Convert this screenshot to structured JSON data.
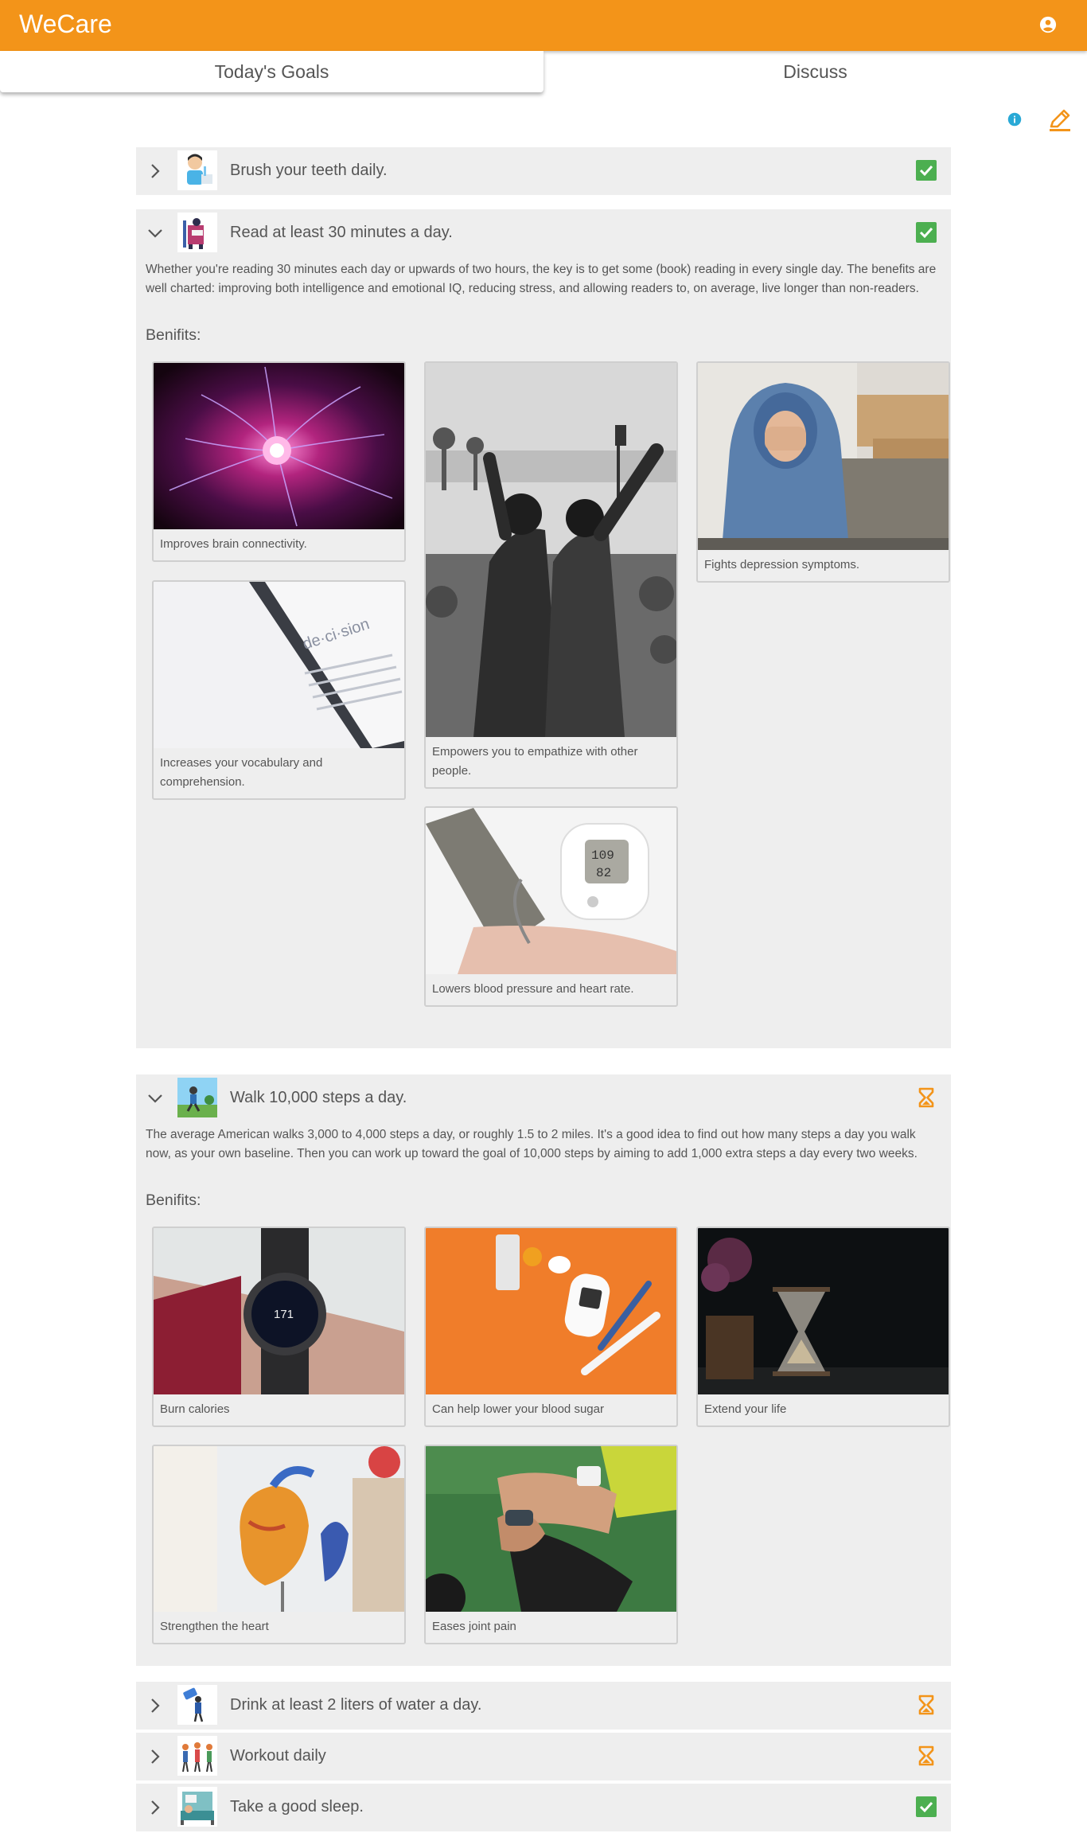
{
  "app": {
    "title": "WeCare"
  },
  "tabs": [
    {
      "label": "Today's Goals"
    },
    {
      "label": "Discuss"
    }
  ],
  "colors": {
    "accent": "#f39419",
    "done": "#4caf50",
    "info": "#29a9d6"
  },
  "toolbar": {
    "info_icon": "info-icon",
    "edit_icon": "pencil-edit-icon"
  },
  "goals": [
    {
      "title": "Brush your teeth daily.",
      "status": "done",
      "expanded": false
    },
    {
      "title": "Read at least 30 minutes a day.",
      "status": "done",
      "expanded": true,
      "description": "Whether you're reading 30 minutes each day or upwards of two hours, the key is to get some (book) reading in every single day. The benefits are well charted: improving both intelligence and emotional IQ, reducing stress, and allowing readers to, on average, live longer than non-readers.",
      "benefits_label": "Benifits:",
      "benefits": [
        {
          "caption": "Improves brain connectivity."
        },
        {
          "caption": "Empowers you to empathize with other people."
        },
        {
          "caption": "Fights depression symptoms."
        },
        {
          "caption": "Increases your vocabulary and comprehension."
        },
        {
          "caption": "Lowers blood pressure and heart rate."
        }
      ]
    },
    {
      "title": "Walk 10,000 steps a day.",
      "status": "pending",
      "expanded": true,
      "description": "The average American walks 3,000 to 4,000 steps a day, or roughly 1.5 to 2 miles. It's a good idea to find out how many steps a day you walk now, as your own baseline. Then you can work up toward the goal of 10,000 steps by aiming to add 1,000 extra steps a day every two weeks.",
      "benefits_label": "Benifits:",
      "benefits": [
        {
          "caption": "Burn calories"
        },
        {
          "caption": "Can help lower your blood sugar"
        },
        {
          "caption": "Extend your life"
        },
        {
          "caption": "Strengthen the heart"
        },
        {
          "caption": "Eases joint pain"
        }
      ]
    },
    {
      "title": "Drink at least 2 liters of water a day.",
      "status": "pending",
      "expanded": false
    },
    {
      "title": "Workout daily",
      "status": "pending",
      "expanded": false
    },
    {
      "title": "Take a good sleep.",
      "status": "done",
      "expanded": false
    }
  ]
}
